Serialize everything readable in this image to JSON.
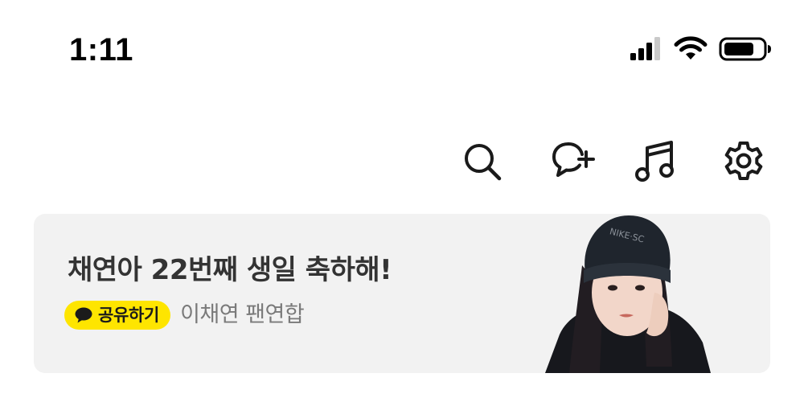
{
  "status_bar": {
    "time": "1:11",
    "icons": [
      "cellular-signal-icon",
      "wifi-icon",
      "battery-icon"
    ]
  },
  "toolbar": {
    "icons": [
      "search-icon",
      "new-chat-icon",
      "music-icon",
      "settings-icon"
    ]
  },
  "banner": {
    "title": "채연아 22번째 생일 축하해!",
    "share_label": "공유하기",
    "channel_name": "이채연 팬연합",
    "background_color": "#f2f2f2",
    "badge_color": "#fee500"
  }
}
